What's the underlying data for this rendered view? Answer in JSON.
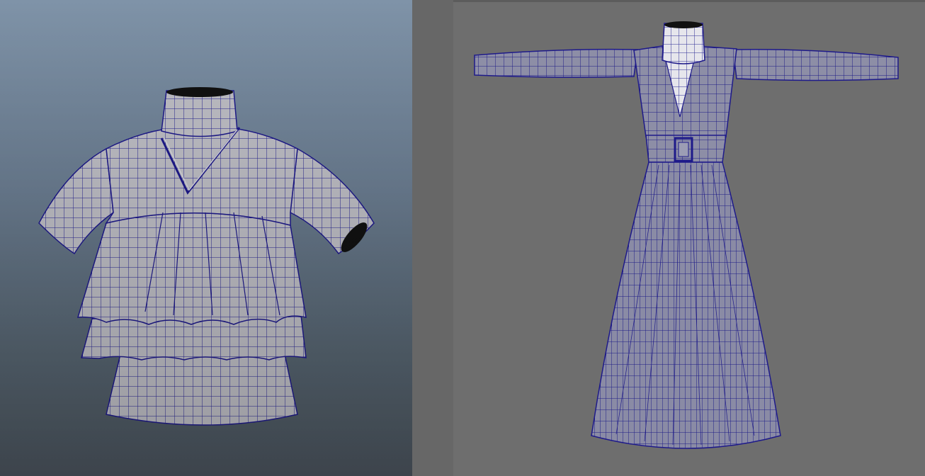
{
  "viewports": [
    {
      "panel": "left",
      "content": "wireframe-blouse-model"
    },
    {
      "panel": "right",
      "content": "wireframe-dress-model"
    }
  ],
  "colors": {
    "left_bg_top": "#7f93a8",
    "left_bg_bottom": "#4a535c",
    "right_bg": "#6e6e6e",
    "mesh_fill": "#b9b9c0",
    "wire": "#1e1a8a"
  }
}
